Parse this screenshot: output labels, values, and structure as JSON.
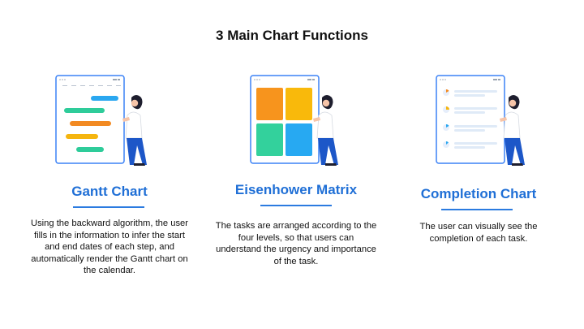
{
  "page": {
    "title": "3 Main Chart Functions"
  },
  "features": [
    {
      "heading": "Gantt Chart",
      "description": "Using the backward algorithm, the user fills in the information to infer the start and end dates of each step, and automatically render the Gantt chart on the calendar.",
      "icon": "gantt-tablet-illustration"
    },
    {
      "heading": "Eisenhower Matrix",
      "description": "The tasks are arranged according to the four levels, so that users can understand the urgency and importance of the task.",
      "icon": "matrix-tablet-illustration"
    },
    {
      "heading": "Completion Chart",
      "description": "The user can visually see the completion of each task.",
      "icon": "completion-tablet-illustration"
    }
  ],
  "colors": {
    "accent": "#1f6fd6",
    "tablet_border": "#3b82f6",
    "bar_blue": "#2aa7f0",
    "bar_green": "#2ecc9a",
    "bar_orange": "#f28a22",
    "bar_yellow": "#f5b50f",
    "matrix_orange": "#f7941d",
    "matrix_yellow": "#f9b90b",
    "matrix_green": "#33d19c",
    "matrix_blue": "#27a9f2"
  }
}
